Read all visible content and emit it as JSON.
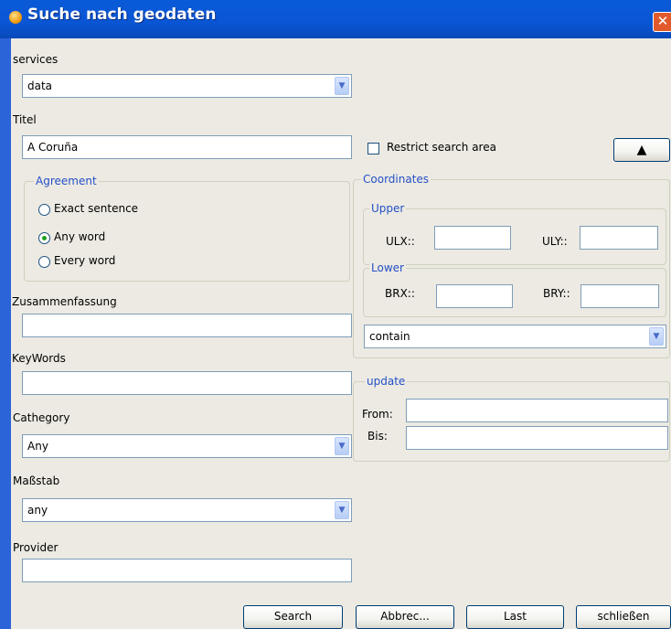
{
  "window": {
    "title": "Suche nach geodaten",
    "close_glyph": "✕"
  },
  "services": {
    "label": "services",
    "selected": "data"
  },
  "titel": {
    "label": "Titel",
    "value": "A Coruña"
  },
  "agreement": {
    "legend": "Agreement",
    "options": [
      {
        "label": "Exact sentence",
        "checked": false
      },
      {
        "label": "Any word",
        "checked": true
      },
      {
        "label": "Every word",
        "checked": false
      }
    ]
  },
  "zusammenfassung": {
    "label": "Zusammenfassung",
    "value": ""
  },
  "keywords": {
    "label": "KeyWords",
    "value": ""
  },
  "cathegory": {
    "label": "Cathegory",
    "selected": "Any"
  },
  "massstab": {
    "label": "Maßstab",
    "selected": "any"
  },
  "provider": {
    "label": "Provider",
    "value": ""
  },
  "restrict": {
    "label": "Restrict search area",
    "checked": false,
    "toggle_glyph": "▲"
  },
  "coordinates": {
    "legend": "Coordinates",
    "upper": {
      "legend": "Upper",
      "ulx_label": "ULX::",
      "uly_label": "ULY::",
      "ulx": "",
      "uly": ""
    },
    "lower": {
      "legend": "Lower",
      "brx_label": "BRX::",
      "bry_label": "BRY::",
      "brx": "",
      "bry": ""
    },
    "relation_selected": "contain"
  },
  "update": {
    "legend": "update",
    "from_label": "From:",
    "bis_label": "Bis:",
    "from": "",
    "bis": ""
  },
  "buttons": {
    "search": "Search",
    "abbrechen": "Abbrec...",
    "last": "Last",
    "schliessen": "schließen"
  },
  "icons": {
    "dropdown": "▼"
  }
}
